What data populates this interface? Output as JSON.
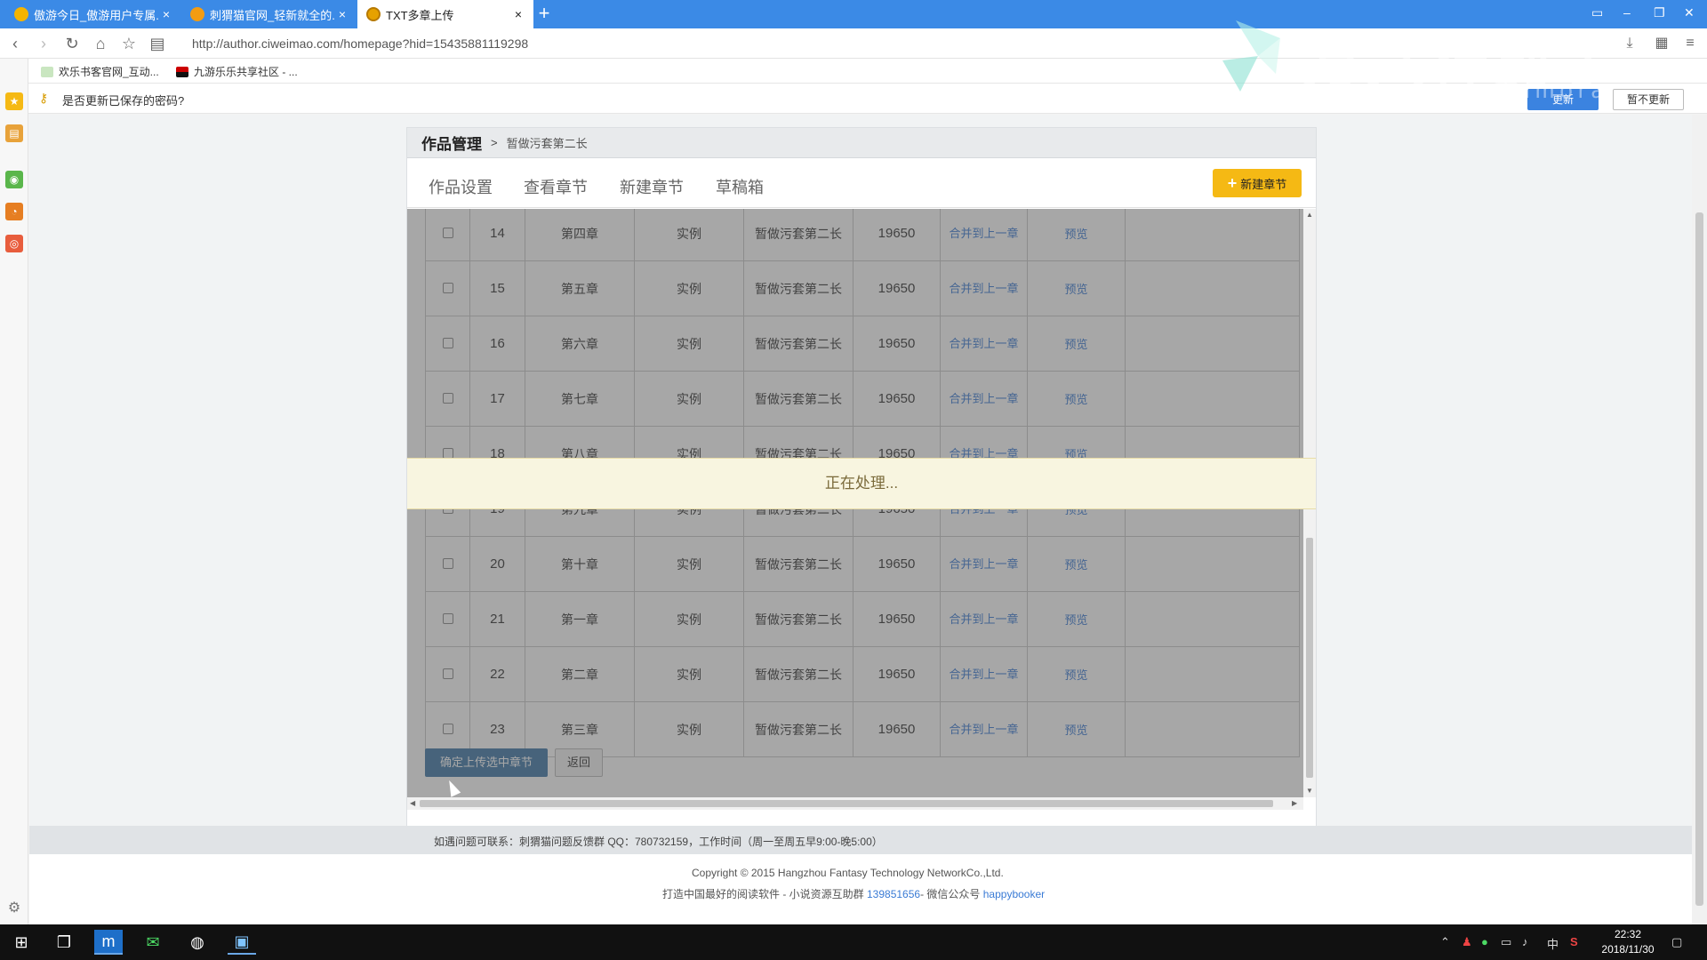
{
  "browser": {
    "tabs": [
      {
        "title": "傲游今日_傲游用户专属..."
      },
      {
        "title": "刺猬猫官网_轻新就全的..."
      },
      {
        "title": "TXT多章上传"
      }
    ],
    "url": "http://author.ciweimao.com/homepage?hid=15435881119298",
    "bookmarks": [
      {
        "label": "欢乐书客官网_互动..."
      },
      {
        "label": "九游乐乐共享社区 - ..."
      }
    ],
    "password_prompt": {
      "text": "是否更新已保存的密码?",
      "update_label": "更新",
      "no_update_label": "暂不更新"
    }
  },
  "watermark": {
    "text": "万兴神剪手",
    "sub": "filmora"
  },
  "page": {
    "breadcrumb": {
      "title": "作品管理",
      "separator": ">",
      "book": "暂做污套第二长"
    },
    "tabs": [
      "作品设置",
      "查看章节",
      "新建章节",
      "草稿箱"
    ],
    "new_chapter_button": "新建章节",
    "processing_text": "正在处理...",
    "rows": [
      {
        "num": "14",
        "chapter": "第四章",
        "type": "实例",
        "book": "暂做污套第二长",
        "words": "19650",
        "merge": "合并到上一章",
        "preview": "预览"
      },
      {
        "num": "15",
        "chapter": "第五章",
        "type": "实例",
        "book": "暂做污套第二长",
        "words": "19650",
        "merge": "合并到上一章",
        "preview": "预览"
      },
      {
        "num": "16",
        "chapter": "第六章",
        "type": "实例",
        "book": "暂做污套第二长",
        "words": "19650",
        "merge": "合并到上一章",
        "preview": "预览"
      },
      {
        "num": "17",
        "chapter": "第七章",
        "type": "实例",
        "book": "暂做污套第二长",
        "words": "19650",
        "merge": "合并到上一章",
        "preview": "预览"
      },
      {
        "num": "18",
        "chapter": "第八章",
        "type": "实例",
        "book": "暂做污套第二长",
        "words": "19650",
        "merge": "合并到上一章",
        "preview": "预览"
      },
      {
        "num": "19",
        "chapter": "第九章",
        "type": "实例",
        "book": "暂做污套第二长",
        "words": "19650",
        "merge": "合并到上一章",
        "preview": "预览"
      },
      {
        "num": "20",
        "chapter": "第十章",
        "type": "实例",
        "book": "暂做污套第二长",
        "words": "19650",
        "merge": "合并到上一章",
        "preview": "预览"
      },
      {
        "num": "21",
        "chapter": "第一章",
        "type": "实例",
        "book": "暂做污套第二长",
        "words": "19650",
        "merge": "合并到上一章",
        "preview": "预览"
      },
      {
        "num": "22",
        "chapter": "第二章",
        "type": "实例",
        "book": "暂做污套第二长",
        "words": "19650",
        "merge": "合并到上一章",
        "preview": "预览"
      },
      {
        "num": "23",
        "chapter": "第三章",
        "type": "实例",
        "book": "暂做污套第二长",
        "words": "19650",
        "merge": "合并到上一章",
        "preview": "预览"
      }
    ],
    "confirm_button": "确定上传选中章节",
    "back_button": "返回",
    "contact": "如遇问题可联系：刺猬猫问题反馈群 QQ：780732159，工作时间（周一至周五早9:00-晚5:00）",
    "copyright": "Copyright © 2015 Hangzhou Fantasy Technology NetworkCo.,Ltd.",
    "footer_prefix": "打造中国最好的阅读软件 - 小说资源互助群 ",
    "footer_qq": "139851656",
    "footer_mid": "- 微信公众号 ",
    "footer_wechat": "happybooker"
  },
  "taskbar": {
    "time": "22:32",
    "date": "2018/11/30",
    "ime": "中"
  },
  "colors": {
    "tabbar": "#3b8ae6",
    "accent_button": "#f5b914",
    "confirm_button": "#3e77a6",
    "link": "#3a7bd5",
    "processing_bg": "#f8f5e0"
  }
}
